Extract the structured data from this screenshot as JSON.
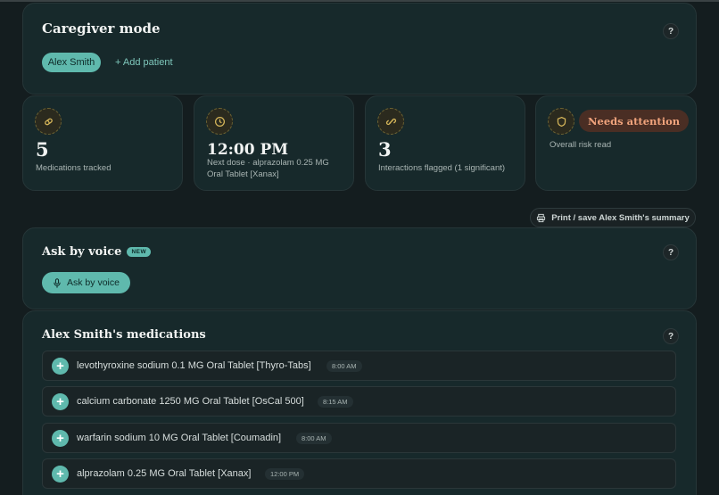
{
  "caregiver": {
    "title": "Caregiver mode",
    "help": "?",
    "patient": "Alex Smith",
    "add_patient": "+ Add patient"
  },
  "stats": [
    {
      "icon": "pill-icon",
      "value": "5",
      "label": "Medications tracked"
    },
    {
      "icon": "clock-icon",
      "value": "12:00 PM",
      "label": "Next dose · alprazolam 0.25 MG Oral Tablet [Xanax]"
    },
    {
      "icon": "link-icon",
      "value": "3",
      "label": "Interactions flagged (1 significant)"
    },
    {
      "icon": "shield-icon",
      "status": "Needs attention",
      "label": "Overall risk read"
    }
  ],
  "print_label": "Print / save Alex Smith's summary",
  "voice": {
    "title": "Ask by voice",
    "badge": "NEW",
    "button": "Ask by voice",
    "help": "?"
  },
  "meds": {
    "title": "Alex Smith's medications",
    "help": "?",
    "items": [
      {
        "name": "levothyroxine sodium 0.1 MG Oral Tablet [Thyro-Tabs]",
        "time": "8:00 AM"
      },
      {
        "name": "calcium carbonate 1250 MG Oral Tablet [OsCal 500]",
        "time": "8:15 AM"
      },
      {
        "name": "warfarin sodium 10 MG Oral Tablet [Coumadin]",
        "time": "8:00 AM"
      },
      {
        "name": "alprazolam 0.25 MG Oral Tablet [Xanax]",
        "time": "12:00 PM"
      }
    ]
  },
  "colors": {
    "background": "#141d1f",
    "card": "#17292b",
    "accent": "#5fb9ad",
    "warning": "#f0a37c",
    "icon_gold": "#d7b75a"
  }
}
